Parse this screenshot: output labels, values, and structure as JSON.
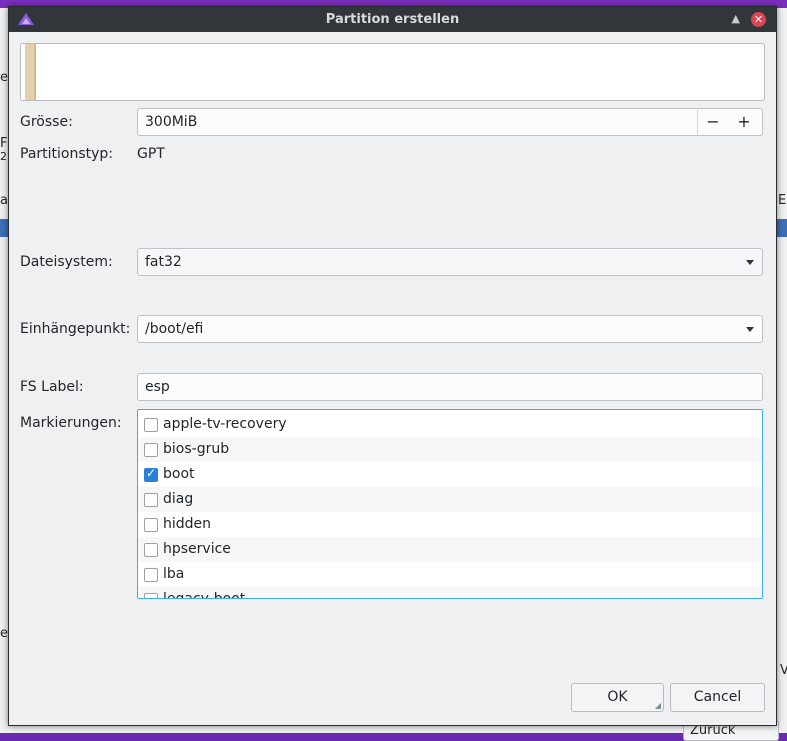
{
  "background": {
    "fragments": [
      "e",
      "F",
      "2",
      "a",
      "E",
      "e",
      "V",
      "Zurück"
    ]
  },
  "dialog": {
    "title": "Partition erstellen",
    "size": {
      "label": "Grösse:",
      "value": "300MiB",
      "minus": "−",
      "plus": "+"
    },
    "partition_type": {
      "label": "Partitionstyp:",
      "value": "GPT"
    },
    "filesystem": {
      "label": "Dateisystem:",
      "value": "fat32"
    },
    "mountpoint": {
      "label": "Einhängepunkt:",
      "value": "/boot/efi"
    },
    "fs_label": {
      "label": "FS Label:",
      "value": "esp"
    },
    "flags": {
      "label": "Markierungen:",
      "items": [
        {
          "label": "apple-tv-recovery",
          "checked": false
        },
        {
          "label": "bios-grub",
          "checked": false
        },
        {
          "label": "boot",
          "checked": true
        },
        {
          "label": "diag",
          "checked": false
        },
        {
          "label": "hidden",
          "checked": false
        },
        {
          "label": "hpservice",
          "checked": false
        },
        {
          "label": "lba",
          "checked": false
        },
        {
          "label": "legacy-boot",
          "checked": false
        }
      ]
    },
    "buttons": {
      "ok": "OK",
      "cancel": "Cancel"
    }
  },
  "colors": {
    "accent": "#3daee9",
    "titlebar": "#31363b",
    "close": "#da4453",
    "partition": "#e1d1b1"
  },
  "icons": [
    "app-logo-icon",
    "window-shade-icon",
    "close-icon",
    "chevron-down-icon",
    "checkbox-icon",
    "resize-grip-icon"
  ]
}
